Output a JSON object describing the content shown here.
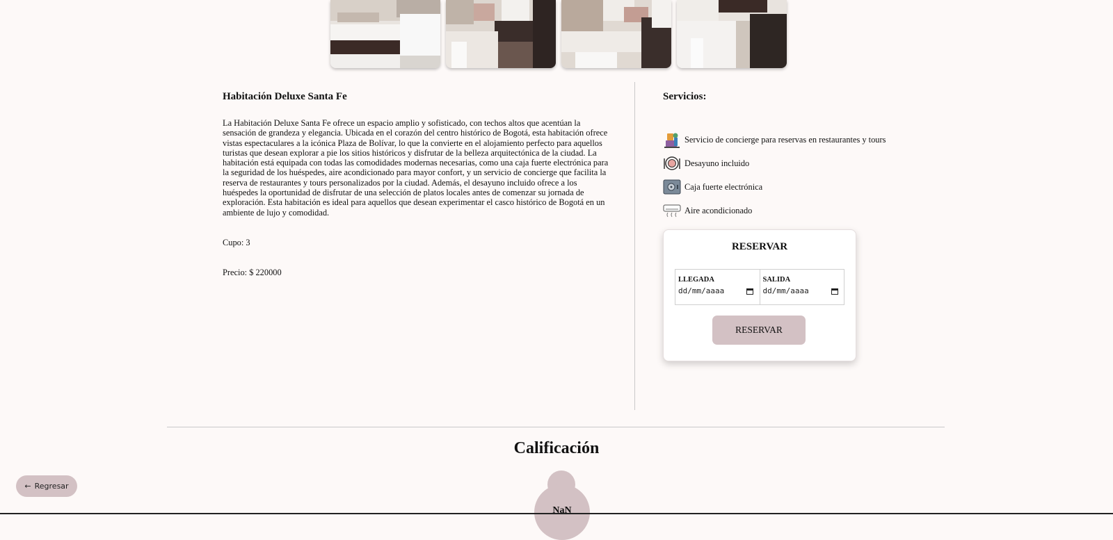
{
  "gallery": {
    "photos": [
      {
        "label": "room-photo-1"
      },
      {
        "label": "room-photo-2"
      },
      {
        "label": "room-photo-3"
      },
      {
        "label": "room-photo-4"
      }
    ]
  },
  "room": {
    "title": "Habitación Deluxe Santa Fe",
    "description": "La Habitación Deluxe Santa Fe ofrece un espacio amplio y sofisticado, con techos altos que acentúan la sensación de grandeza y elegancia. Ubicada en el corazón del centro histórico de Bogotá, esta habitación ofrece vistas espectaculares a la icónica Plaza de Bolívar, lo que la convierte en el alojamiento perfecto para aquellos turistas que desean explorar a pie los sitios históricos y disfrutar de la belleza arquitectónica de la ciudad. La habitación está equipada con todas las comodidades modernas necesarias, como una caja fuerte electrónica para la seguridad de los huéspedes, aire acondicionado para mayor confort, y un servicio de concierge que facilita la reserva de restaurantes y tours personalizados por la ciudad. Además, el desayuno incluido ofrece a los huéspedes la oportunidad de disfrutar de una selección de platos locales antes de comenzar su jornada de exploración. Esta habitación es ideal para aquellos que desean experimentar el casco histórico de Bogotá en un ambiente de lujo y comodidad.",
    "cupo": "Cupo: 3",
    "precio": "Precio: $ 220000"
  },
  "services": {
    "title": "Servicios:",
    "items": [
      {
        "label": "Servicio de concierge para reservas en restaurantes y tours",
        "icon": "concierge-icon"
      },
      {
        "label": "Desayuno incluido",
        "icon": "breakfast-icon"
      },
      {
        "label": "Caja fuerte electrónica",
        "icon": "safe-icon"
      },
      {
        "label": "Aire acondicionado",
        "icon": "air-conditioner-icon"
      }
    ]
  },
  "booking": {
    "title": "RESERVAR",
    "arrival_label": "LLEGADA",
    "arrival_placeholder": "dd/mm/aaaa",
    "departure_label": "SALIDA",
    "departure_placeholder": "dd/mm/aaaa",
    "button_label": "RESERVAR"
  },
  "rating": {
    "title": "Calificación",
    "value": "NaN"
  },
  "nav": {
    "back_label": "Regresar",
    "back_icon": "arrow-left-icon"
  },
  "colors": {
    "background": "#fdf9f8",
    "accent": "#d3c1c4"
  }
}
